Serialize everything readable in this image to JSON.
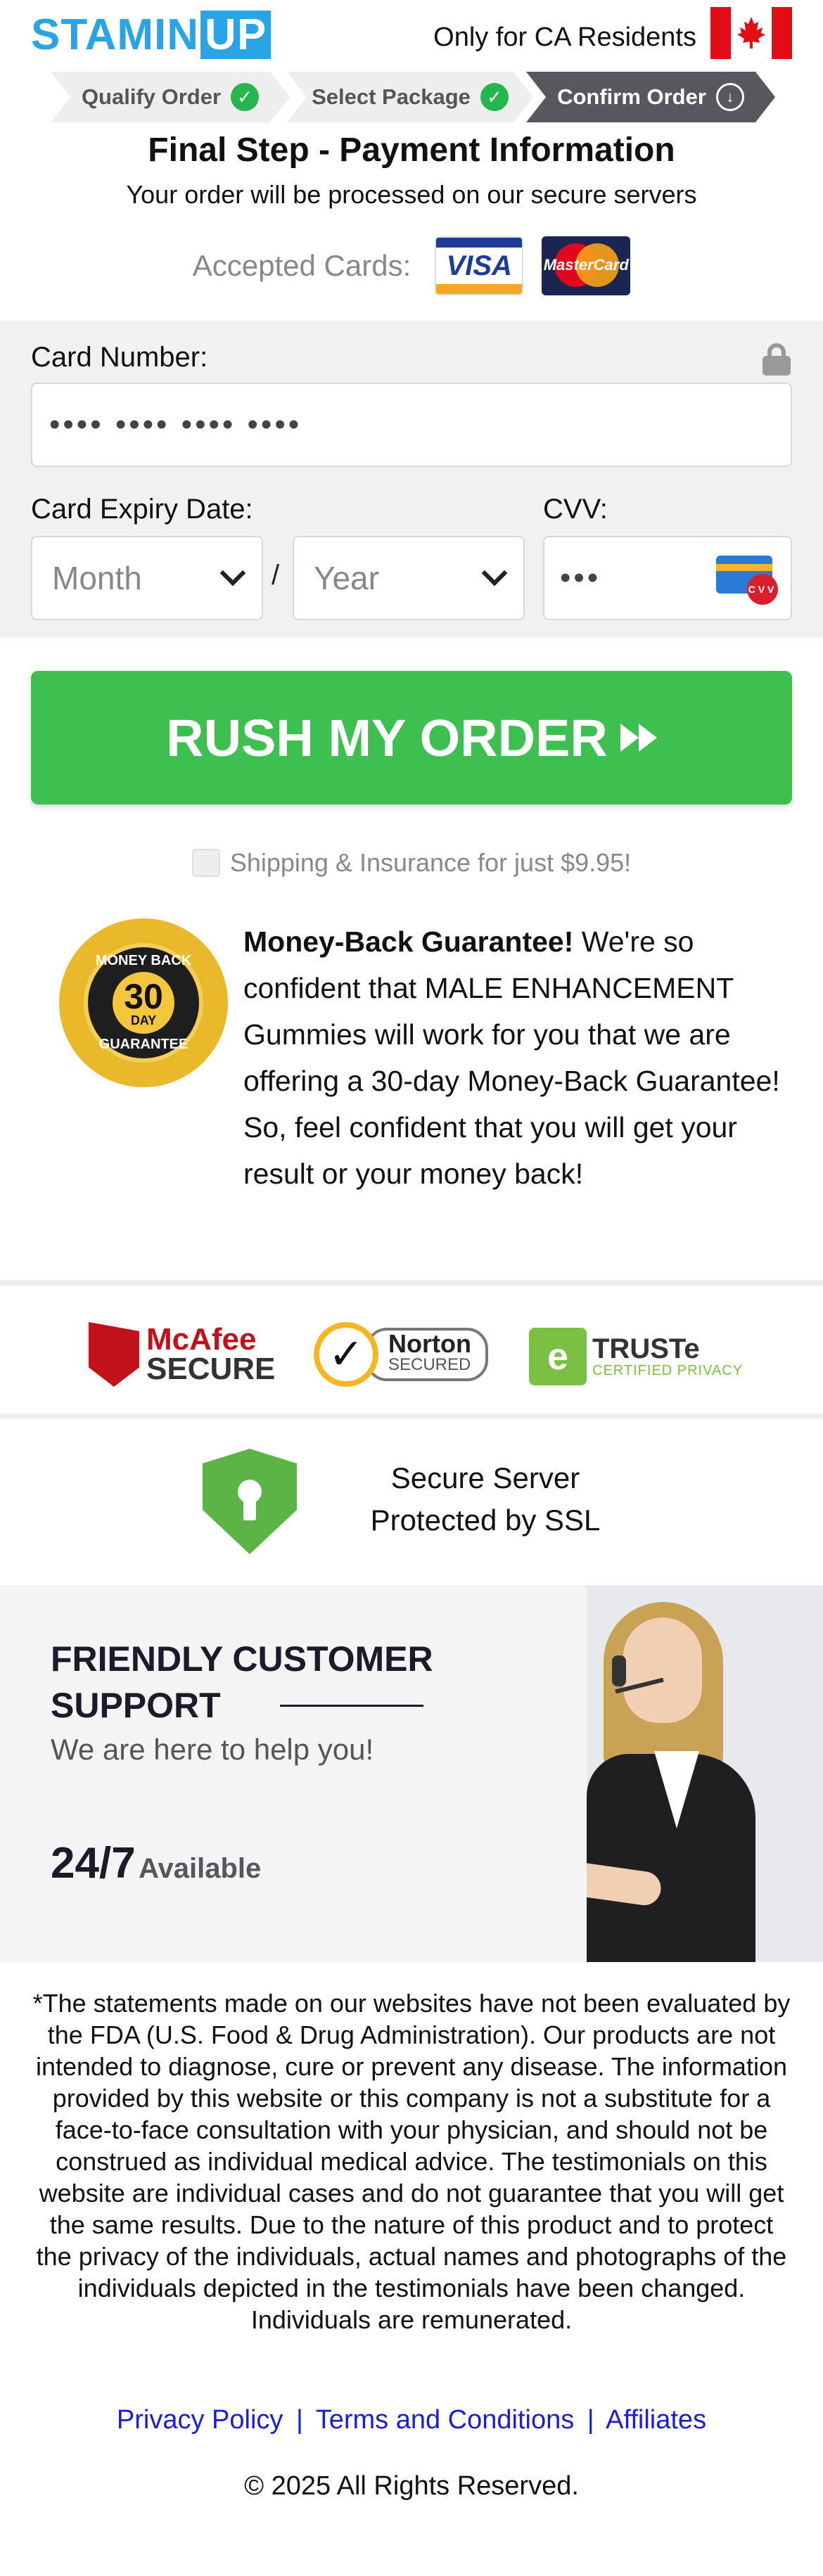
{
  "header": {
    "logo_main": "STAMIN",
    "logo_accent": "UP",
    "residents": "Only for CA Residents",
    "flag_icon": "canada-flag-icon"
  },
  "steps": [
    {
      "label": "Qualify Order",
      "state": "done"
    },
    {
      "label": "Select Package",
      "state": "done"
    },
    {
      "label": "Confirm Order",
      "state": "current"
    }
  ],
  "page": {
    "title": "Final Step - Payment Information",
    "subtitle": "Your order will be processed on our secure servers",
    "accepted_cards_label": "Accepted Cards:",
    "visa_label": "VISA",
    "mastercard_label": "MasterCard"
  },
  "form": {
    "card_number_label": "Card Number:",
    "card_number_value": "•••• •••• •••• ••••",
    "expiry_label": "Card Expiry Date:",
    "month_placeholder": "Month",
    "slash": "/",
    "year_placeholder": "Year",
    "cvv_label": "CVV:",
    "cvv_value": "•••",
    "cvv_badge": "CVV"
  },
  "cta": {
    "label": "RUSH MY ORDER",
    "button_color": "#3dc050"
  },
  "shipping": {
    "label": "Shipping & Insurance for just $9.95!"
  },
  "guarantee": {
    "seal_top": "MONEY BACK",
    "seal_number": "30",
    "seal_day": "DAY",
    "seal_bottom": "GUARANTEE",
    "heading": "Money-Back Guarantee!",
    "text": " We're so confident that MALE ENHANCEMENT Gummies will work for you that we are offering a 30-day Money-Back Guarantee! So, feel confident that you will get your result or your money back!"
  },
  "trust": {
    "mcafee_a": "McAfee",
    "mcafee_b": "SECURE",
    "norton_a": "Norton",
    "norton_b": "SECURED",
    "truste_a": "TRUSTe",
    "truste_b": "CERTIFIED PRIVACY"
  },
  "ssl": {
    "line1": "Secure Server",
    "line2": "Protected by SSL"
  },
  "support": {
    "title": "FRIENDLY CUSTOMER SUPPORT",
    "help": "We are here to help you!",
    "hours": "24/7",
    "available": "Available"
  },
  "disclaimer": "*The statements made on our websites have not been evaluated by the FDA (U.S. Food & Drug Administration). Our products are not intended to diagnose, cure or prevent any disease. The information provided by this website or this company is not a substitute for a face-to-face consultation with your physician, and should not be construed as individual medical advice. The testimonials on this website are individual cases and do not guarantee that you will get the same results. Due to the nature of this product and to protect the privacy of the individuals, actual names and photographs of the individuals depicted in the testimonials have been changed. Individuals are remunerated.",
  "footer": {
    "privacy": "Privacy Policy",
    "terms": "Terms and Conditions",
    "affiliates": "Affiliates",
    "separator": "|",
    "copyright": "© 2025 All Rights Reserved."
  }
}
